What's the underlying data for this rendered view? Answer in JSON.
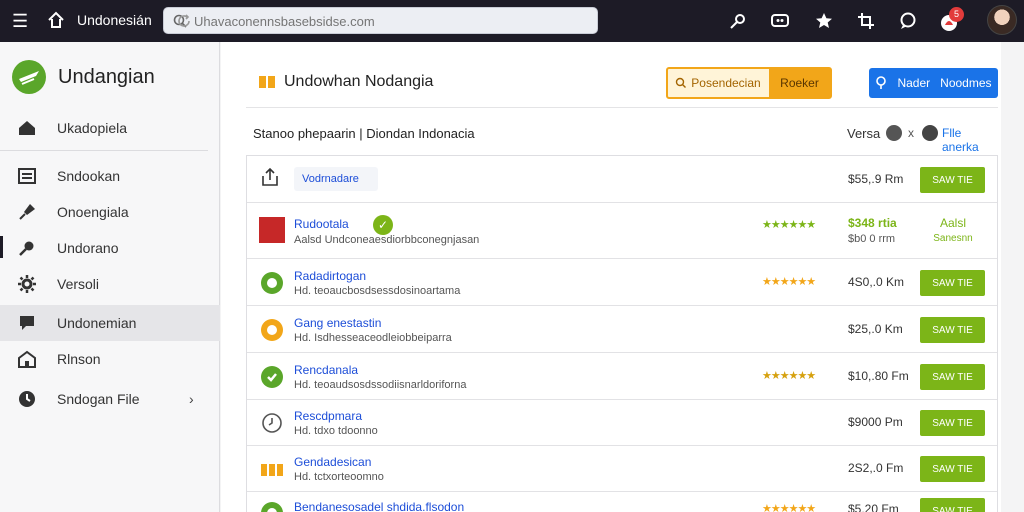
{
  "topbar": {
    "title": "Undonesián",
    "search_placeholder": "Uhavaconennsbasebsidse.com",
    "notification_count": "5",
    "icons": [
      "menu-icon",
      "home-icon",
      "search-icon",
      "refresh-icon",
      "key-icon",
      "chat-icon",
      "star-icon",
      "crop-icon",
      "bubble-icon",
      "bell-icon"
    ]
  },
  "sidebar": {
    "brand": "Undangian",
    "items": [
      {
        "label": "Ukadopiela",
        "icon": "home-icon"
      },
      {
        "label": "Sndookan",
        "icon": "list-icon"
      },
      {
        "label": "Onoengiala",
        "icon": "pin-icon"
      },
      {
        "label": "Undorano",
        "icon": "key-icon"
      },
      {
        "label": "Versoli",
        "icon": "gear-icon"
      },
      {
        "label": "Undonemian",
        "icon": "flag-icon"
      },
      {
        "label": "Rlnson",
        "icon": "building-icon"
      },
      {
        "label": "Sndogan File",
        "icon": "clock-icon"
      }
    ],
    "chevron": "›"
  },
  "main": {
    "title": "Undowhan Nodangia",
    "btn_orange_left": "Posendecian",
    "btn_orange_right": "Roeker",
    "btn_blue_a": "Nader",
    "btn_blue_b": "Noodmes",
    "subtitle": "Stanoo phepaarin | Diondan Indonacia",
    "vers_label": "Versa",
    "vers_sep": "x",
    "vers_link": "Flle anerka",
    "first_row": {
      "tag": "Vodrnadare",
      "price": "$55,.9 Rm",
      "button": "SAW TIE"
    },
    "rows": [
      {
        "name": "Rudootala",
        "desc": "Aalsd Undconeaesdiorbbconegnjasan",
        "stars": "★★★★★★",
        "price": "$348 rtia",
        "price2": "$b0 0 rrm",
        "hl1": "Aalsl",
        "hl2": "Sanesnn",
        "icon_color": "#c62828",
        "star_color": "#7cb518"
      },
      {
        "name": "Radadirtogan",
        "desc": "Hd. teoaucbosdsessdosinoartama",
        "stars": "★★★★★★",
        "price": "4S0,.0 Km",
        "button": "SAW TIE",
        "icon_color": "#5aa62a",
        "star_color": "#f2a619"
      },
      {
        "name": "Gang enestastin",
        "desc": "Hd. Isdhesseaceodleiobbeiparra",
        "stars": "",
        "price": "$25,.0 Km",
        "button": "SAW TIE",
        "icon_color": "#f2a619",
        "star_color": "#f2a619"
      },
      {
        "name": "Rencdanala",
        "desc": "Hd. teoaudsosdssodiisnarldoriforna",
        "stars": "★★★★★★",
        "price": "$10,.80 Fm",
        "button": "SAW TIE",
        "icon_color": "#5aa62a",
        "star_color": "#d6a10f"
      },
      {
        "name": "Rescdpmara",
        "desc": "Hd. tdxo tdoonno",
        "stars": "",
        "price": "$9000 Pm",
        "button": "SAW TIE",
        "icon_color": "#555555",
        "star_color": "#7cb518"
      },
      {
        "name": "Gendadesican",
        "desc": "Hd. tctxorteoomno",
        "stars": "",
        "price": "2S2,.0 Fm",
        "button": "SAW TIE",
        "icon_color": "#f2a619",
        "star_color": "#7cb518"
      },
      {
        "name": "Bendanesosadel shdida.flsodon",
        "desc": "",
        "stars": "★★★★★★",
        "price": "$5,20 Fm",
        "button": "SAW TIE",
        "icon_color": "#5aa62a",
        "star_color": "#f2a619"
      }
    ]
  },
  "colors": {
    "accent_green": "#7cb518",
    "accent_orange": "#f2a619",
    "accent_blue": "#1a73e8",
    "topbar": "#1d1b26"
  }
}
